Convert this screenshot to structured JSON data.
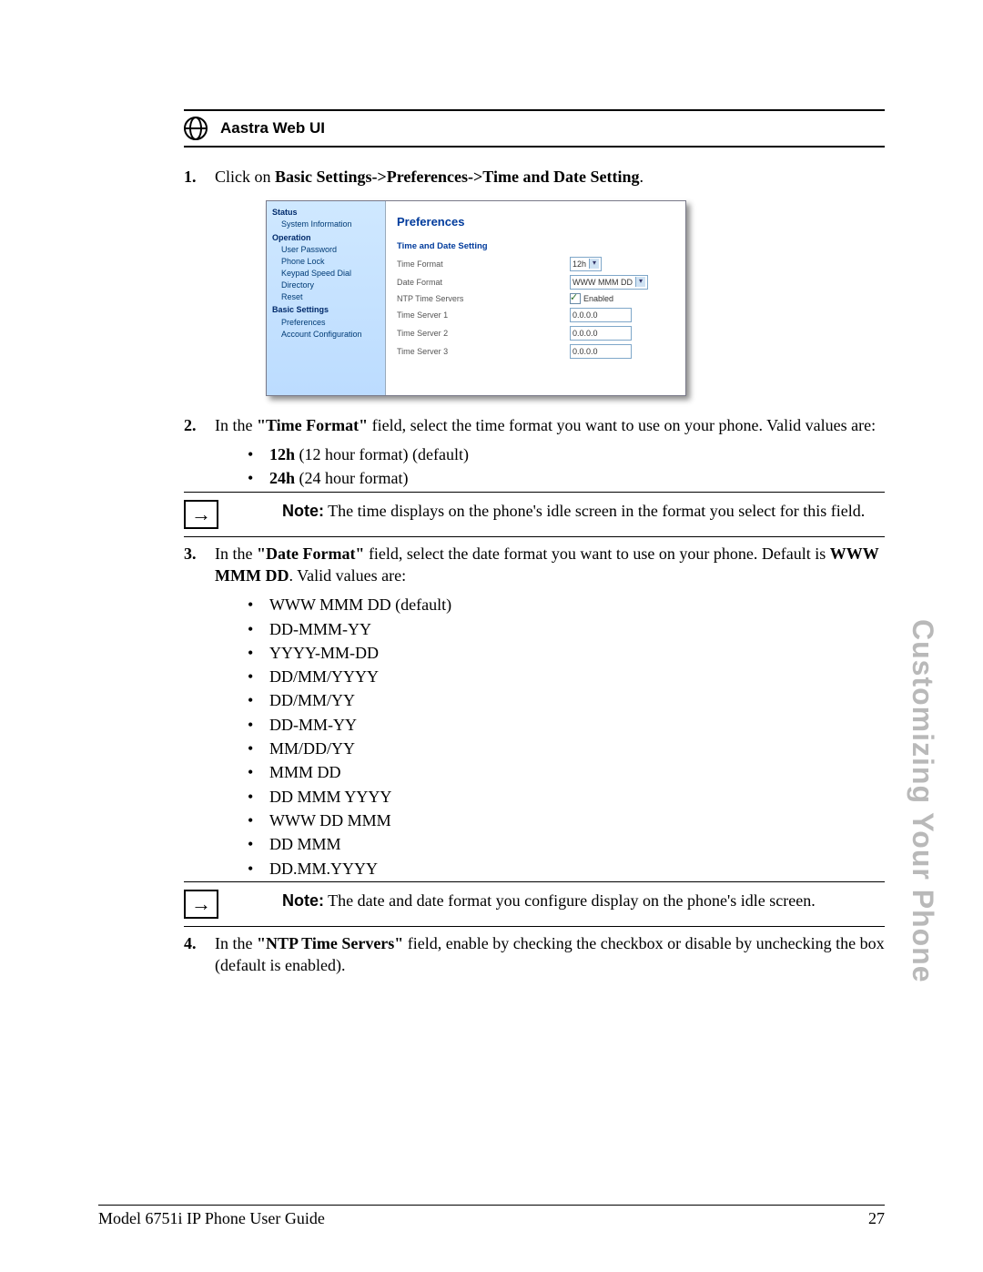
{
  "section_title": "Aastra Web UI",
  "sidetab": "Customizing Your Phone",
  "footer": {
    "left": "Model 6751i IP Phone User Guide",
    "right": "27"
  },
  "steps": {
    "s1": {
      "num": "1.",
      "pre": "Click on ",
      "bold": "Basic Settings->Preferences->Time and Date Setting",
      "post": "."
    },
    "s2": {
      "num": "2.",
      "pre": "In the ",
      "bold1": "\"Time Format\"",
      "mid": " field, select the time format you want to use on your phone. Valid values are:",
      "opts": [
        {
          "bold": "12h",
          "rest": " (12 hour format) (default)"
        },
        {
          "bold": "24h",
          "rest": " (24 hour format)"
        }
      ]
    },
    "s3": {
      "num": "3.",
      "pre": "In the ",
      "bold1": "\"Date Format\"",
      "mid1": " field, select the date format you want to use on your phone. Default is ",
      "bold2": "WWW MMM DD",
      "mid2": ". Valid values are:",
      "opts": [
        "WWW MMM DD (default)",
        "DD-MMM-YY",
        "YYYY-MM-DD",
        "DD/MM/YYYY",
        "DD/MM/YY",
        "DD-MM-YY",
        "MM/DD/YY",
        "MMM DD",
        "DD MMM YYYY",
        "WWW DD MMM",
        "DD MMM",
        "DD.MM.YYYY"
      ]
    },
    "s4": {
      "num": "4.",
      "pre": "In the ",
      "bold1": "\"NTP Time Servers\"",
      "post": " field, enable by checking the checkbox or disable by unchecking the box (default is enabled)."
    }
  },
  "notes": {
    "n1": {
      "label": "Note:",
      "text": " The time displays on the phone's idle screen in the format you select for this field."
    },
    "n2": {
      "label": "Note:",
      "text": " The date and date format you configure display on the phone's idle screen."
    }
  },
  "webui": {
    "nav": {
      "status": "Status",
      "sys_info": "System Information",
      "operation": "Operation",
      "user_pw": "User Password",
      "phone_lock": "Phone Lock",
      "keypad": "Keypad Speed Dial",
      "directory": "Directory",
      "reset": "Reset",
      "basic": "Basic Settings",
      "preferences": "Preferences",
      "account": "Account Configuration"
    },
    "panel": {
      "title": "Preferences",
      "group": "Time and Date Setting",
      "rows": {
        "time_format": {
          "label": "Time Format",
          "value": "12h"
        },
        "date_format": {
          "label": "Date Format",
          "value": "WWW MMM DD"
        },
        "ntp": {
          "label": "NTP Time Servers",
          "value": "Enabled"
        },
        "ts1": {
          "label": "Time Server 1",
          "value": "0.0.0.0"
        },
        "ts2": {
          "label": "Time Server 2",
          "value": "0.0.0.0"
        },
        "ts3": {
          "label": "Time Server 3",
          "value": "0.0.0.0"
        }
      }
    }
  }
}
